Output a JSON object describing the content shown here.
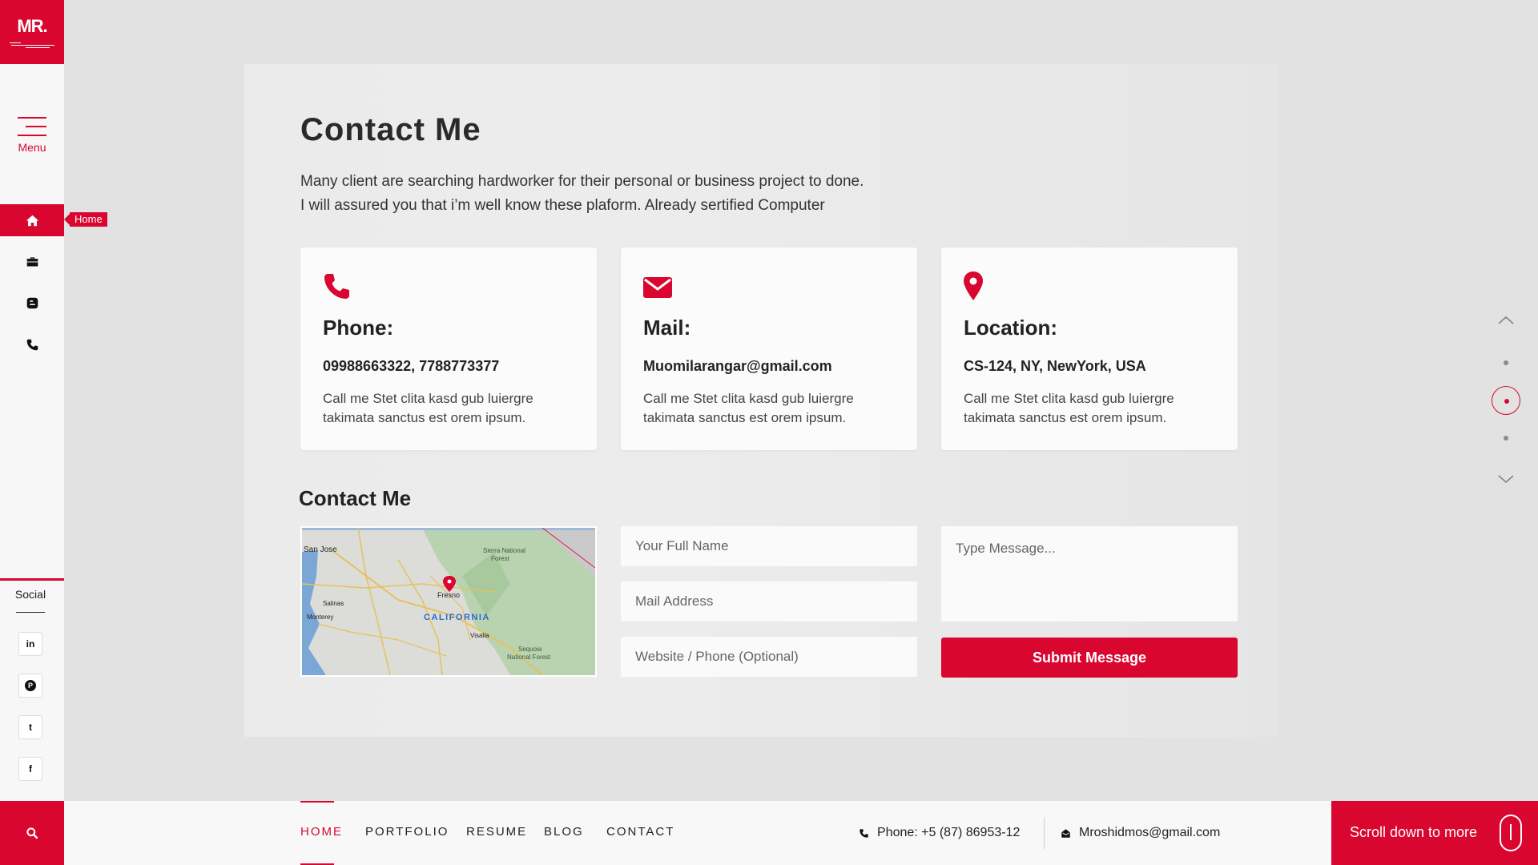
{
  "brand": {
    "logo_text": "MR."
  },
  "sidebar": {
    "menu_label": "Menu",
    "tooltip": "Home",
    "items": [
      {
        "icon": "home-icon"
      },
      {
        "icon": "briefcase-icon"
      },
      {
        "icon": "blogger-icon"
      },
      {
        "icon": "phone-icon"
      }
    ],
    "social_label": "Social",
    "social": [
      {
        "icon": "linkedin-icon",
        "glyph": "in"
      },
      {
        "icon": "pinterest-icon",
        "glyph": "P"
      },
      {
        "icon": "twitter-icon",
        "glyph": "t"
      },
      {
        "icon": "facebook-icon",
        "glyph": "f"
      }
    ]
  },
  "main": {
    "title": "Contact Me",
    "intro_line1": "Many client are searching hardworker for their personal or business project to done.",
    "intro_line2": "I will assured you that i’m well know these plaform. Already sertified Computer",
    "cards": [
      {
        "icon": "phone-icon",
        "title": "Phone:",
        "value": "09988663322, 7788773377",
        "desc": "Call me Stet clita kasd gub luiergre takimata sanctus est orem ipsum."
      },
      {
        "icon": "envelope-icon",
        "title": "Mail:",
        "value": "Muomilarangar@gmail.com",
        "desc": "Call me Stet clita kasd gub luiergre takimata sanctus est orem ipsum."
      },
      {
        "icon": "map-pin-icon",
        "title": "Location:",
        "value": "CS-124, NY, NewYork, USA",
        "desc": "Call me Stet clita kasd gub luiergre takimata sanctus est orem ipsum."
      }
    ],
    "form_title": "Contact Me",
    "map_labels": {
      "city1": "San Jose",
      "city2": "Fresno",
      "city3": "Salinas",
      "city4": "Monterey",
      "city5": "Visalia",
      "state": "CALIFORNIA",
      "park1a": "Sierra National",
      "park1b": "Forest",
      "park2a": "Sequoia",
      "park2b": "National Forest"
    },
    "form": {
      "name_placeholder": "Your Full Name",
      "mail_placeholder": "Mail Address",
      "website_placeholder": "Website / Phone (Optional)",
      "message_placeholder": "Type Message...",
      "submit_label": "Submit Message"
    }
  },
  "footer": {
    "nav": [
      "HOME",
      "PORTFOLIO",
      "RESUME",
      "BLOG",
      "CONTACT"
    ],
    "phone": "Phone: +5 (87) 86953-12",
    "email": "Mroshidmos@gmail.com",
    "scroll_label": "Scroll down to more"
  },
  "colors": {
    "accent": "#d9062f",
    "background": "#e2e2e2",
    "card": "#fbfbfb"
  }
}
